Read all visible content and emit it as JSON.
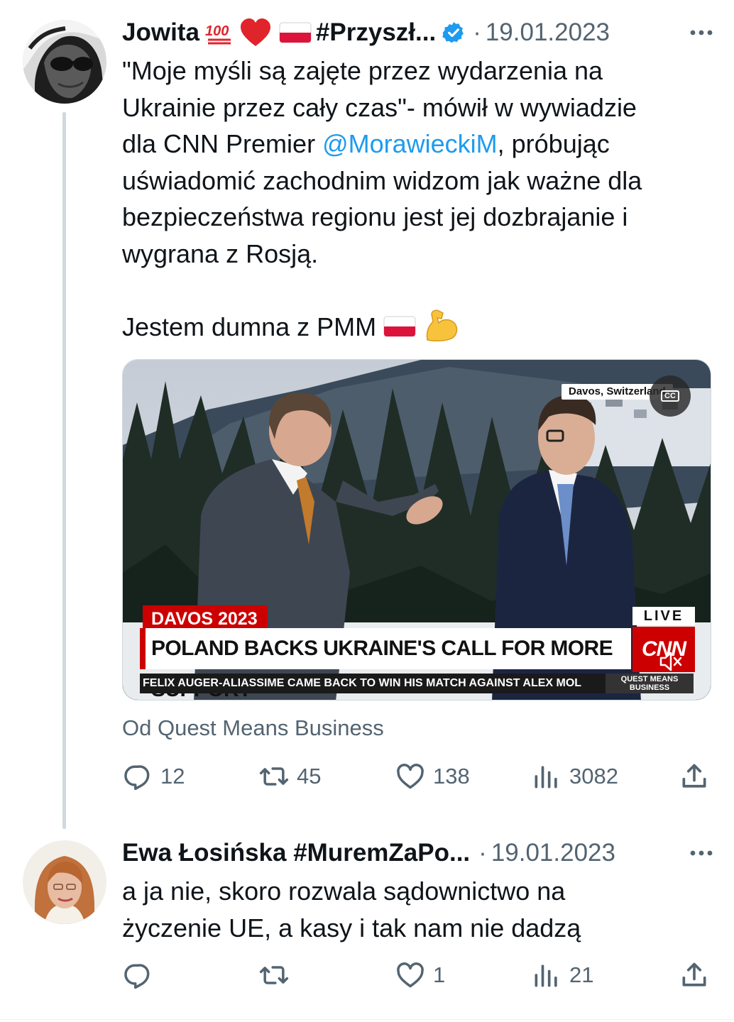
{
  "tweet1": {
    "name": "Jowita",
    "hashtag": "#Przyszł...",
    "date": "19.01.2023",
    "text_before_mention": "\"Moje myśli są zajęte przez wydarzenia na\nUkrainie przez cały czas\"- mówił w wywiadzie\ndla CNN Premier ",
    "mention": "@MorawieckiM",
    "text_after_mention": ", próbując\nuświadomić zachodnim widzom jak ważne dla\nbezpieczeństwa regionu jest jej dozbrajanie i\nwygrana z Rosją.\n\nJestem dumna z PMM ",
    "media": {
      "location": "Davos, Switzerland",
      "cc": "CC",
      "event_label": "DAVOS 2023",
      "headline": "POLAND BACKS UKRAINE'S CALL FOR MORE SUPPORT",
      "ticker": "FELIX AUGER-ALIASSIME CAME BACK TO WIN HIS MATCH AGAINST ALEX MOL",
      "live": "LIVE",
      "network": "CNN",
      "show_line1": "QUEST MEANS",
      "show_line2": "BUSINESS"
    },
    "source": "Od Quest Means Business",
    "replies": "12",
    "retweets": "45",
    "likes": "138",
    "views": "3082"
  },
  "tweet2": {
    "name": "Ewa Łosińska #MuremZaPo...",
    "date": "19.01.2023",
    "text": "a ja nie, skoro rozwala sądownictwo na\nżyczenie UE, a kasy i tak nam nie dadzą",
    "replies": "",
    "retweets": "",
    "likes": "1",
    "views": "21"
  },
  "separator": "·",
  "icons": [
    "verified-badge-icon",
    "more-icon",
    "reply-icon",
    "retweet-icon",
    "like-icon",
    "views-icon",
    "share-icon",
    "hundred-points-emoji",
    "red-heart-emoji",
    "poland-flag-emoji",
    "flexed-biceps-emoji",
    "mute-icon"
  ],
  "colors": {
    "text": "#0f1419",
    "secondary": "#536471",
    "link": "#1d9bf0",
    "thread_line": "#cfd9de",
    "cnn_red": "#cc0000"
  }
}
